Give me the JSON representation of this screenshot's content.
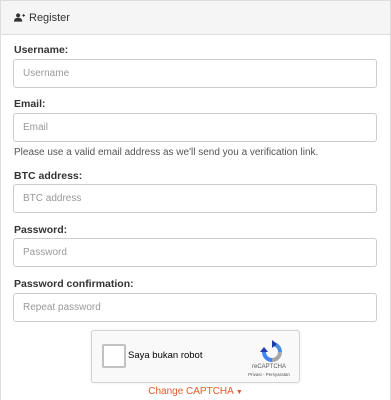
{
  "panel": {
    "title": "Register",
    "icon": "user-plus-icon"
  },
  "form": {
    "username": {
      "label": "Username:",
      "placeholder": "Username",
      "value": ""
    },
    "email": {
      "label": "Email:",
      "placeholder": "Email",
      "value": "",
      "help": "Please use a valid email address as we'll send you a verification link."
    },
    "btc": {
      "label": "BTC address:",
      "placeholder": "BTC address",
      "value": ""
    },
    "password": {
      "label": "Password:",
      "placeholder": "Password",
      "value": ""
    },
    "password_confirm": {
      "label": "Password confirmation:",
      "placeholder": "Repeat password",
      "value": ""
    }
  },
  "captcha": {
    "checkbox_label": "Saya bukan robot",
    "brand": "reCAPTCHA",
    "terms": "Privasi - Persyaratan",
    "change_label": "Change CAPTCHA",
    "change_icon": "caret-down-icon"
  },
  "colors": {
    "accent": "#e05a2b",
    "heading_bg": "#f5f5f5",
    "border": "#cccccc"
  }
}
